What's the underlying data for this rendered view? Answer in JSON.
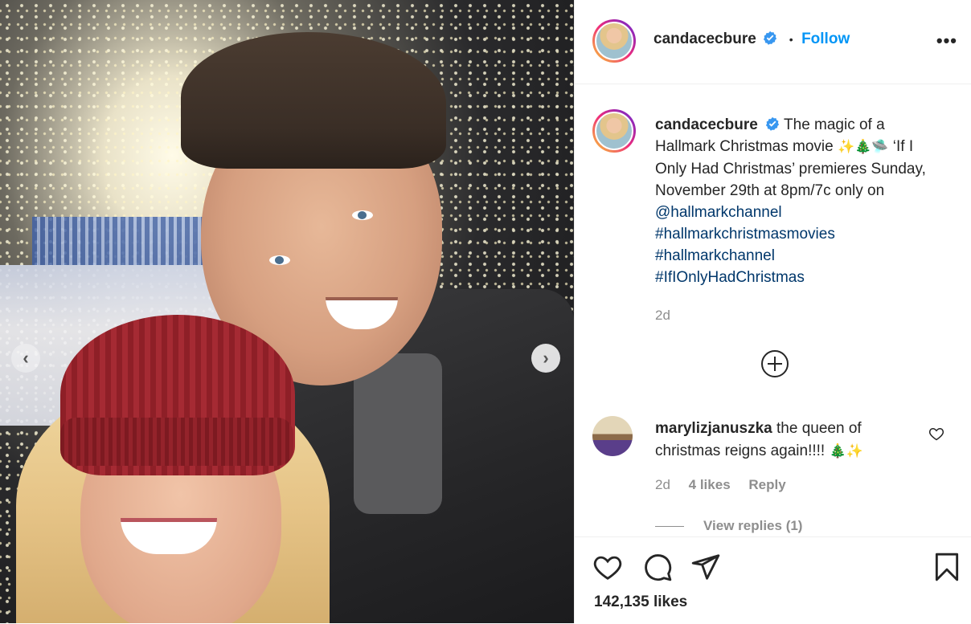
{
  "post": {
    "username": "candacecbure",
    "follow_label": "Follow",
    "separator": "•",
    "more_label": "•••"
  },
  "caption": {
    "username": "candacecbure",
    "text_line1": "The magic of a Hallmark Christmas movie",
    "emojis_line1": "✨🎄🛸",
    "text_line2": "‘If I Only Had Christmas’ premieres Sunday, November 29th at 8pm/7c only on",
    "mention": "@hallmarkchannel",
    "hashtags": [
      "#hallmarkchristmasmovies",
      "#hallmarkchannel",
      "#IfIOnlyHadChristmas"
    ],
    "time": "2d"
  },
  "comment": {
    "username": "marylizjanuszka",
    "text": "the queen of christmas reigns again!!!!",
    "emojis": "🎄✨",
    "time": "2d",
    "likes": "4 likes",
    "reply_label": "Reply",
    "view_replies": "View replies (1)"
  },
  "footer": {
    "likes": "142,135 likes"
  },
  "icons": {
    "prev": "chevron-left-icon",
    "next": "chevron-right-icon",
    "verified": "verified-badge-icon",
    "more": "more-options-icon",
    "plus": "load-more-comments-icon",
    "heart": "heart-icon",
    "comment": "comment-icon",
    "share": "share-icon",
    "save": "bookmark-icon"
  },
  "colors": {
    "accent": "#0095f6",
    "link": "#00376b",
    "muted": "#8e8e8e",
    "text": "#262626"
  }
}
